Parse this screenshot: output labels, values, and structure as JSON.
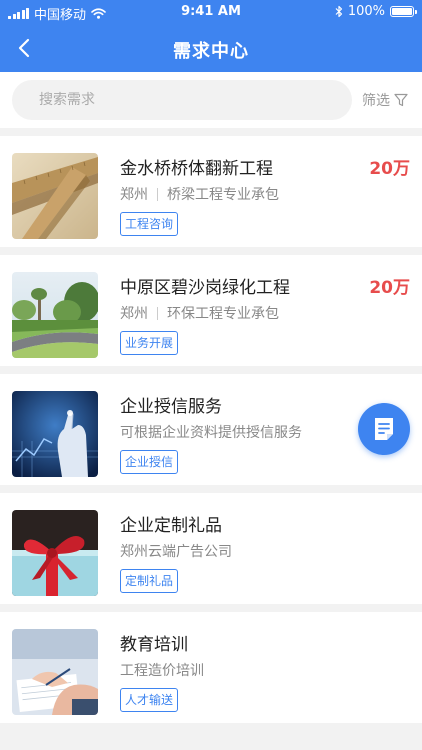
{
  "status_bar": {
    "carrier": "中国移动",
    "time": "9:41 AM",
    "battery": "100%"
  },
  "nav": {
    "title": "需求中心"
  },
  "search": {
    "placeholder": "搜索需求",
    "filter_label": "筛选"
  },
  "items": [
    {
      "title": "金水桥桥体翻新工程",
      "location": "郑州",
      "category": "桥梁工程专业承包",
      "tag": "工程咨询",
      "price": "20万"
    },
    {
      "title": "中原区碧沙岗绿化工程",
      "location": "郑州",
      "category": "环保工程专业承包",
      "tag": "业务开展",
      "price": "20万"
    },
    {
      "title": "企业授信服务",
      "description": "可根据企业资料提供授信服务",
      "tag": "企业授信"
    },
    {
      "title": "企业定制礼品",
      "description": "郑州云端广告公司",
      "tag": "定制礼品"
    },
    {
      "title": "教育培训",
      "description": "工程造价培训",
      "tag": "人才输送"
    }
  ],
  "colors": {
    "primary": "#3e84f0",
    "price": "#e74c4c"
  }
}
